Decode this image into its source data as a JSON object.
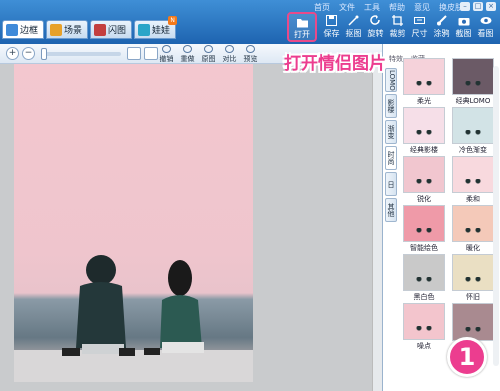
{
  "top_menu": [
    "首页",
    "文件",
    "工具",
    "帮助",
    "意见",
    "换皮肤"
  ],
  "mode_tabs": [
    {
      "label": "边框",
      "color": "#3f8ad9",
      "active": true
    },
    {
      "label": "场景",
      "color": "#e7a12a"
    },
    {
      "label": "闪图",
      "color": "#c33f3f"
    },
    {
      "label": "娃娃",
      "color": "#2aa5c8",
      "badge": "N"
    }
  ],
  "toolbar": [
    {
      "label": "打开",
      "icon": "folder-icon"
    },
    {
      "label": "保存",
      "icon": "save-icon"
    },
    {
      "label": "抠图",
      "icon": "magic-wand-icon"
    },
    {
      "label": "旋转",
      "icon": "rotate-icon"
    },
    {
      "label": "裁剪",
      "icon": "crop-icon"
    },
    {
      "label": "尺寸",
      "icon": "resize-icon"
    },
    {
      "label": "涂鸦",
      "icon": "brush-icon"
    },
    {
      "label": "截图",
      "icon": "camera-icon"
    },
    {
      "label": "看图",
      "icon": "eye-icon"
    }
  ],
  "edit_buttons": [
    {
      "label": "撤销",
      "icon": "undo-icon"
    },
    {
      "label": "重做",
      "icon": "redo-icon"
    },
    {
      "label": "原图",
      "icon": "original-icon"
    },
    {
      "label": "对比",
      "icon": "compare-icon"
    },
    {
      "label": "预览",
      "icon": "preview-icon"
    }
  ],
  "panel_header": [
    "特效",
    "收藏"
  ],
  "vertical_tabs": [
    "LOMO",
    "影楼",
    "渐变",
    "时尚",
    "日",
    "其他"
  ],
  "effects": [
    {
      "label": "柔光",
      "tint": "#f5d2da"
    },
    {
      "label": "经典LOMO",
      "tint": "#6b5a66"
    },
    {
      "label": "经典影楼",
      "tint": "#f6dfe8"
    },
    {
      "label": "冷色渐变",
      "tint": "#d2e3e6"
    },
    {
      "label": "锐化",
      "tint": "#f1c6cf"
    },
    {
      "label": "柔和",
      "tint": "#f8d9de"
    },
    {
      "label": "智能绘色",
      "tint": "#ef9aa8"
    },
    {
      "label": "暖化",
      "tint": "#f4c9b9"
    },
    {
      "label": "黑白色",
      "tint": "#c9c9c9"
    },
    {
      "label": "怀旧",
      "tint": "#eadfc3"
    },
    {
      "label": "噪点",
      "tint": "#f3c5cd"
    },
    {
      "label": "",
      "tint": "#a98a90"
    }
  ],
  "annotation": {
    "title": "打开情侣图片",
    "step": "1"
  }
}
